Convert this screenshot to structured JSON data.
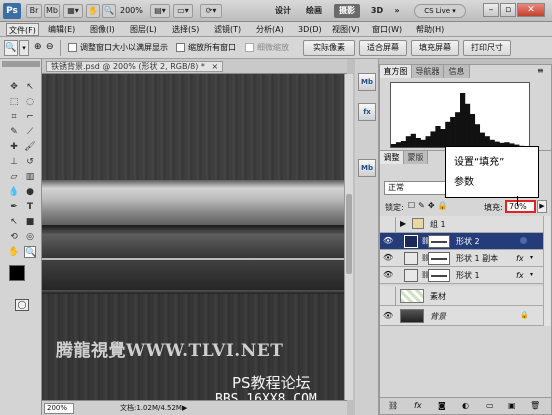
{
  "titlebar": {
    "logo": "Ps",
    "zoom": "200%",
    "workspaces": [
      "设计",
      "绘画",
      "摄影",
      "3D"
    ],
    "active_workspace": "摄影",
    "more": "»",
    "cs_live": "CS Live ▾"
  },
  "menu": [
    "文件(F)",
    "编辑(E)",
    "图像(I)",
    "图层(L)",
    "选择(S)",
    "滤镜(T)",
    "分析(A)",
    "3D(D)",
    "视图(V)",
    "窗口(W)",
    "帮助(H)"
  ],
  "options": {
    "resize_windows": "调整窗口大小以满屏显示",
    "zoom_all": "缩放所有窗口",
    "scrubby_zoom": "细微缩放",
    "actual_pixels": "实际像素",
    "fit_screen": "适合屏幕",
    "fill_screen": "填充屏幕",
    "print_size": "打印尺寸"
  },
  "document": {
    "tab_title": "铁锈背景.psd @ 200% (形状 2, RGB/8) *",
    "watermark_main": "腾龍視覺WWW.TLVI.NET",
    "watermark_forum": "PS教程论坛",
    "watermark_url": "BBS.16XX8.COM",
    "zoom_status": "200%",
    "doc_info": "文档:1.02M/4.52M"
  },
  "histogram": {
    "tabs": [
      "直方图",
      "导航器",
      "信息"
    ],
    "bars": [
      0.05,
      0.08,
      0.1,
      0.18,
      0.22,
      0.15,
      0.12,
      0.18,
      0.26,
      0.35,
      0.3,
      0.42,
      0.5,
      0.58,
      0.9,
      0.72,
      0.55,
      0.38,
      0.24,
      0.18,
      0.12,
      0.09,
      0.07,
      0.08,
      0.06,
      0.04,
      0.02,
      0.01
    ]
  },
  "layers": {
    "tabs": [
      "调整",
      "蒙版"
    ],
    "blend_mode": "正常",
    "lock_label": "锁定:",
    "fill_label": "填充:",
    "fill_value": "70%",
    "items": [
      {
        "name": "组 1",
        "type": "group"
      },
      {
        "name": "形状 2",
        "type": "shape",
        "selected": true
      },
      {
        "name": "形状 1 副本",
        "type": "shape",
        "fx": "fx"
      },
      {
        "name": "形状 1",
        "type": "shape",
        "fx": "fx"
      },
      {
        "name": "素材",
        "type": "pattern"
      },
      {
        "name": "背景",
        "type": "bg",
        "lock": "🔒"
      }
    ]
  },
  "callout": {
    "line1": "设置“填充”",
    "line2": "参数"
  },
  "panel_strip": [
    "Mb",
    "fx",
    "Mb"
  ],
  "colors": {
    "selected_layer": "#243c7a",
    "fill_highlight": "#e0241c",
    "workspace_active": "#6a6a6a"
  }
}
